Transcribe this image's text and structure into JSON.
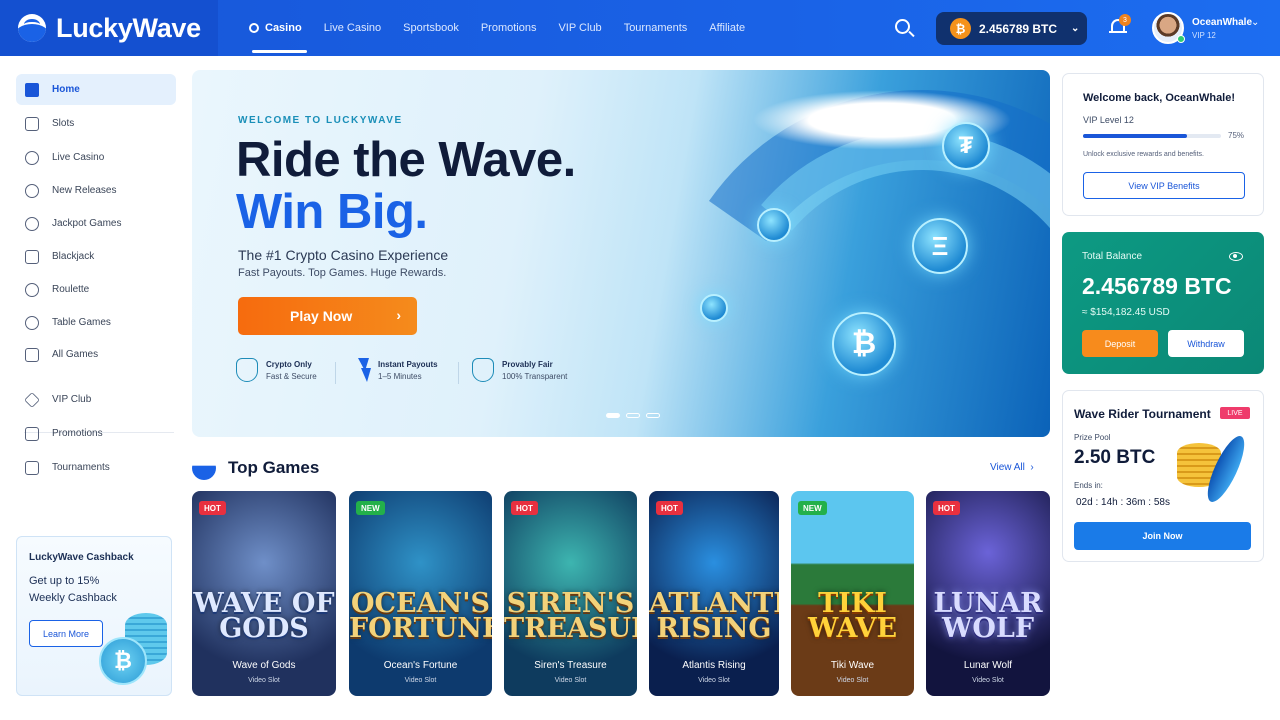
{
  "brand": {
    "name": "LuckyWave"
  },
  "nav": [
    {
      "label": "Casino",
      "active": true
    },
    {
      "label": "Live Casino"
    },
    {
      "label": "Sportsbook"
    },
    {
      "label": "Promotions"
    },
    {
      "label": "VIP Club"
    },
    {
      "label": "Tournaments"
    },
    {
      "label": "Affiliate"
    }
  ],
  "header": {
    "balance": "2.456789 BTC",
    "currency_symbol": "₿",
    "notifications": "3",
    "user_name": "OceanWhale",
    "user_level": "VIP 12"
  },
  "sidebar": {
    "items": [
      {
        "label": "Home",
        "icon": "home-icon"
      },
      {
        "label": "Slots",
        "icon": "slots-icon"
      },
      {
        "label": "Live Casino",
        "icon": "live-casino-icon"
      },
      {
        "label": "New Releases",
        "icon": "star-icon"
      },
      {
        "label": "Jackpot Games",
        "icon": "jackpot-icon"
      },
      {
        "label": "Blackjack",
        "icon": "cards-icon"
      },
      {
        "label": "Roulette",
        "icon": "roulette-icon"
      },
      {
        "label": "Table Games",
        "icon": "table-games-icon"
      },
      {
        "label": "All Games",
        "icon": "grid-icon"
      },
      {
        "label": "VIP Club",
        "icon": "diamond-icon"
      },
      {
        "label": "Promotions",
        "icon": "gift-icon"
      },
      {
        "label": "Tournaments",
        "icon": "trophy-icon"
      }
    ],
    "cashback": {
      "title": "LuckyWave Cashback",
      "text": "Get up to 15% Weekly Cashback",
      "button": "Learn More",
      "coin_symbol": "₿"
    }
  },
  "hero": {
    "eyebrow": "WELCOME TO LUCKYWAVE",
    "title_line1": "Ride the Wave.",
    "title_line2": "Win Big.",
    "subtitle": "The #1 Crypto Casino Experience",
    "subtitle2": "Fast Payouts. Top Games. Huge Rewards.",
    "cta": "Play Now",
    "features": [
      {
        "title": "Crypto Only",
        "sub": "Fast & Secure"
      },
      {
        "title": "Instant Payouts",
        "sub": "1–5 Minutes"
      },
      {
        "title": "Provably Fair",
        "sub": "100% Transparent"
      }
    ],
    "coin_symbols": [
      "₮",
      "Ξ",
      "₿"
    ],
    "slide_count": 3,
    "active_slide": 1
  },
  "top_games": {
    "title": "Top Games",
    "view_all": "View All",
    "games": [
      {
        "name": "Wave of Gods",
        "art": "WAVE OF GODS",
        "type": "Video Slot",
        "badge": "HOT"
      },
      {
        "name": "Ocean's Fortune",
        "art": "OCEAN'S FORTUNE",
        "type": "Video Slot",
        "badge": "NEW"
      },
      {
        "name": "Siren's Treasure",
        "art": "SIREN'S TREASURE",
        "type": "Video Slot",
        "badge": "HOT"
      },
      {
        "name": "Atlantis Rising",
        "art": "ATLANTIS RISING",
        "type": "Video Slot",
        "badge": "HOT"
      },
      {
        "name": "Tiki Wave",
        "art": "TIKI WAVE",
        "type": "Video Slot",
        "badge": "NEW"
      },
      {
        "name": "Lunar Wolf",
        "art": "LUNAR WOLF",
        "type": "Video Slot",
        "badge": "HOT"
      }
    ]
  },
  "vip_panel": {
    "greeting": "Welcome back, OceanWhale!",
    "level": "VIP Level 12",
    "progress": 0.75,
    "progress_label": "75%",
    "note": "Unlock exclusive rewards and benefits.",
    "button": "View VIP Benefits"
  },
  "balance_panel": {
    "label": "Total Balance",
    "amount": "2.456789 BTC",
    "usd": "≈ $154,182.45 USD",
    "deposit": "Deposit",
    "withdraw": "Withdraw"
  },
  "tournament": {
    "title": "Wave Rider Tournament",
    "live": "LIVE",
    "prize_label": "Prize Pool",
    "prize": "2.50 BTC",
    "ends_label": "Ends in:",
    "ends": "02d : 14h : 36m : 58s",
    "button": "Join Now"
  }
}
